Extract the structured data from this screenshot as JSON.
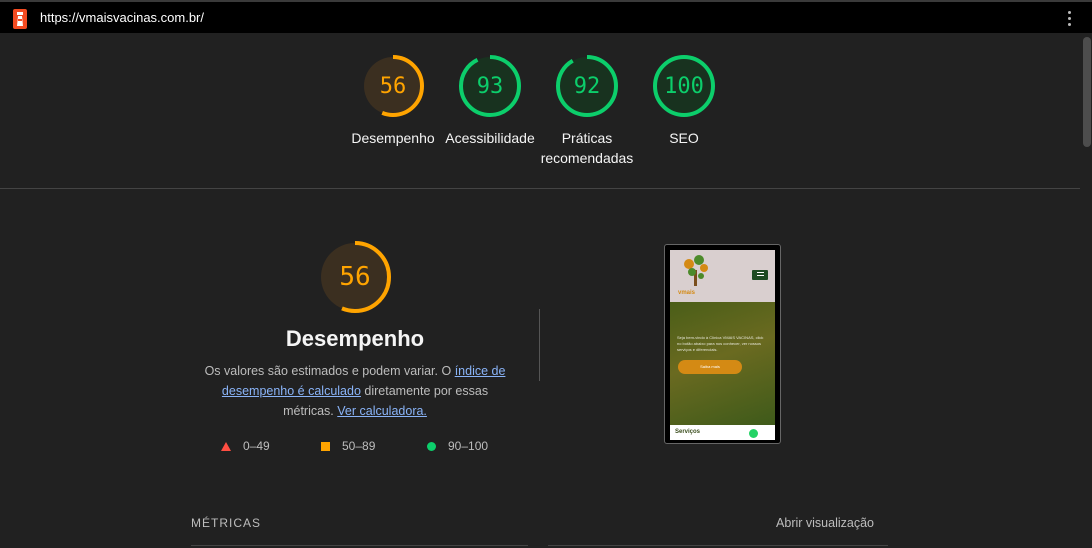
{
  "browser": {
    "url": "https://vmaisvacinas.com.br/"
  },
  "colors": {
    "average": "#ffa400",
    "pass": "#0cce6b",
    "fail": "#ff4e42"
  },
  "summary": [
    {
      "label": "Desempenho",
      "score": "56",
      "status": "average"
    },
    {
      "label": "Acessibilidade",
      "score": "93",
      "status": "pass"
    },
    {
      "label": "Práticas recomendadas",
      "score": "92",
      "status": "pass"
    },
    {
      "label": "SEO",
      "score": "100",
      "status": "pass"
    }
  ],
  "performance": {
    "score": "56",
    "title": "Desempenho",
    "desc_pre": "Os valores são estimados e podem variar. O ",
    "desc_link1": "índice de desempenho é calculado",
    "desc_mid": " diretamente por essas métricas. ",
    "desc_link2": "Ver calculadora."
  },
  "legend": {
    "fail": "0–49",
    "average": "50–89",
    "pass": "90–100"
  },
  "screenshot": {
    "hero_text": "Seja bem-vindo à Clínica VMAIS VACINAS, click no botão abaixo para nos conhecer, ver nossos serviços e diferenciais.",
    "button": "Saiba mais",
    "bottom": "Serviços",
    "logo_text": "vmais"
  },
  "metrics": {
    "heading": "MÉTRICAS",
    "open_view": "Abrir visualização"
  }
}
